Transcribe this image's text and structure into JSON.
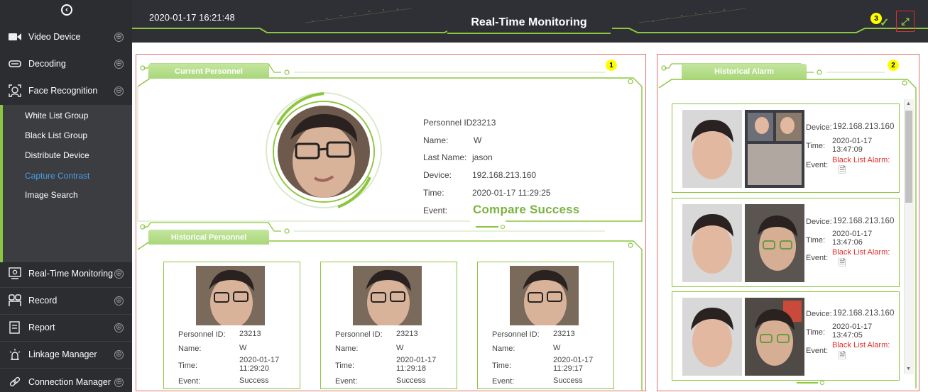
{
  "sidebar": {
    "items": [
      {
        "label": "Video Device",
        "icon": "video-camera-icon"
      },
      {
        "label": "Decoding",
        "icon": "decoder-icon"
      },
      {
        "label": "Face Recognition",
        "icon": "face-scan-icon"
      },
      {
        "label": "Real-Time Monitoring",
        "icon": "monitor-icon"
      },
      {
        "label": "Record",
        "icon": "record-icon"
      },
      {
        "label": "Report",
        "icon": "report-icon"
      },
      {
        "label": "Linkage Manager",
        "icon": "alarm-light-icon"
      },
      {
        "label": "Connection Manager",
        "icon": "link-icon"
      }
    ],
    "face_recognition_sub": [
      {
        "label": "White List Group"
      },
      {
        "label": "Black List Group"
      },
      {
        "label": "Distribute Device"
      },
      {
        "label": "Capture Contrast"
      },
      {
        "label": "Image Search"
      }
    ],
    "expand_symbol": "⊕",
    "collapse_symbol": "⊖"
  },
  "header": {
    "datetime": "2020-01-17 16:21:48",
    "title": "Real-Time Monitoring",
    "badge": "3"
  },
  "badges": {
    "current_panel": "1",
    "alarm_panel": "2"
  },
  "current_personnel": {
    "section_title": "Current Personnel",
    "fields": [
      {
        "label": "Personnel ID:",
        "value": "23213"
      },
      {
        "label": "Name:",
        "value": "W"
      },
      {
        "label": "Last Name:",
        "value": "jason"
      },
      {
        "label": "Device:",
        "value": "192.168.213.160"
      },
      {
        "label": "Time:",
        "value": "2020-01-17 11:29:25"
      },
      {
        "label": "Event:",
        "value": "Compare Success"
      }
    ]
  },
  "historical_personnel": {
    "section_title": "Historical Personnel",
    "labels": {
      "id": "Personnel ID:",
      "name": "Name:",
      "time": "Time:",
      "event": "Event:"
    },
    "cards": [
      {
        "id": "23213",
        "name": "W",
        "date": "2020-01-17",
        "time": "11:29:20",
        "event": "Success"
      },
      {
        "id": "23213",
        "name": "W",
        "date": "2020-01-17",
        "time": "11:29:18",
        "event": "Success"
      },
      {
        "id": "23213",
        "name": "W",
        "date": "2020-01-17",
        "time": "11:29:17",
        "event": "Success"
      }
    ]
  },
  "historical_alarm": {
    "section_title": "Historical Alarm",
    "labels": {
      "device": "Device:",
      "time": "Time:",
      "event": "Event:"
    },
    "cards": [
      {
        "device": "192.168.213.160",
        "date": "2020-01-17",
        "time": "13:47:09",
        "event": "Black List Alarm:"
      },
      {
        "device": "192.168.213.160",
        "date": "2020-01-17",
        "time": "13:47:06",
        "event": "Black List Alarm:"
      },
      {
        "device": "192.168.213.160",
        "date": "2020-01-17",
        "time": "13:47:05",
        "event": "Black List Alarm:"
      }
    ]
  },
  "colors": {
    "accent": "#8cc63e",
    "alarm": "#e03030",
    "sidebar": "#2b2d30",
    "active_link": "#4a9de8"
  }
}
